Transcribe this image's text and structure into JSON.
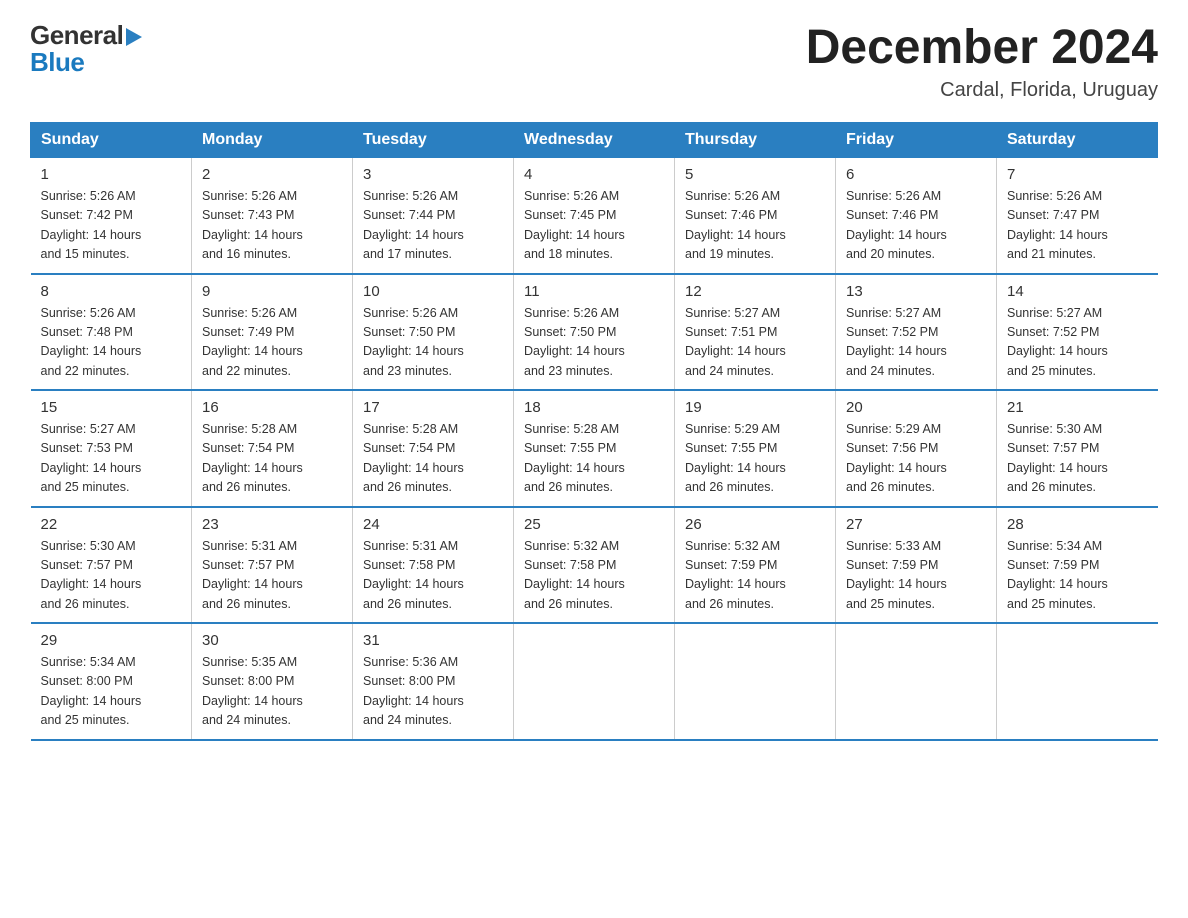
{
  "header": {
    "logo_general": "General",
    "logo_blue": "Blue",
    "month": "December 2024",
    "location": "Cardal, Florida, Uruguay"
  },
  "days_of_week": [
    "Sunday",
    "Monday",
    "Tuesday",
    "Wednesday",
    "Thursday",
    "Friday",
    "Saturday"
  ],
  "weeks": [
    [
      {
        "num": "1",
        "sunrise": "5:26 AM",
        "sunset": "7:42 PM",
        "daylight": "14 hours and 15 minutes."
      },
      {
        "num": "2",
        "sunrise": "5:26 AM",
        "sunset": "7:43 PM",
        "daylight": "14 hours and 16 minutes."
      },
      {
        "num": "3",
        "sunrise": "5:26 AM",
        "sunset": "7:44 PM",
        "daylight": "14 hours and 17 minutes."
      },
      {
        "num": "4",
        "sunrise": "5:26 AM",
        "sunset": "7:45 PM",
        "daylight": "14 hours and 18 minutes."
      },
      {
        "num": "5",
        "sunrise": "5:26 AM",
        "sunset": "7:46 PM",
        "daylight": "14 hours and 19 minutes."
      },
      {
        "num": "6",
        "sunrise": "5:26 AM",
        "sunset": "7:46 PM",
        "daylight": "14 hours and 20 minutes."
      },
      {
        "num": "7",
        "sunrise": "5:26 AM",
        "sunset": "7:47 PM",
        "daylight": "14 hours and 21 minutes."
      }
    ],
    [
      {
        "num": "8",
        "sunrise": "5:26 AM",
        "sunset": "7:48 PM",
        "daylight": "14 hours and 22 minutes."
      },
      {
        "num": "9",
        "sunrise": "5:26 AM",
        "sunset": "7:49 PM",
        "daylight": "14 hours and 22 minutes."
      },
      {
        "num": "10",
        "sunrise": "5:26 AM",
        "sunset": "7:50 PM",
        "daylight": "14 hours and 23 minutes."
      },
      {
        "num": "11",
        "sunrise": "5:26 AM",
        "sunset": "7:50 PM",
        "daylight": "14 hours and 23 minutes."
      },
      {
        "num": "12",
        "sunrise": "5:27 AM",
        "sunset": "7:51 PM",
        "daylight": "14 hours and 24 minutes."
      },
      {
        "num": "13",
        "sunrise": "5:27 AM",
        "sunset": "7:52 PM",
        "daylight": "14 hours and 24 minutes."
      },
      {
        "num": "14",
        "sunrise": "5:27 AM",
        "sunset": "7:52 PM",
        "daylight": "14 hours and 25 minutes."
      }
    ],
    [
      {
        "num": "15",
        "sunrise": "5:27 AM",
        "sunset": "7:53 PM",
        "daylight": "14 hours and 25 minutes."
      },
      {
        "num": "16",
        "sunrise": "5:28 AM",
        "sunset": "7:54 PM",
        "daylight": "14 hours and 26 minutes."
      },
      {
        "num": "17",
        "sunrise": "5:28 AM",
        "sunset": "7:54 PM",
        "daylight": "14 hours and 26 minutes."
      },
      {
        "num": "18",
        "sunrise": "5:28 AM",
        "sunset": "7:55 PM",
        "daylight": "14 hours and 26 minutes."
      },
      {
        "num": "19",
        "sunrise": "5:29 AM",
        "sunset": "7:55 PM",
        "daylight": "14 hours and 26 minutes."
      },
      {
        "num": "20",
        "sunrise": "5:29 AM",
        "sunset": "7:56 PM",
        "daylight": "14 hours and 26 minutes."
      },
      {
        "num": "21",
        "sunrise": "5:30 AM",
        "sunset": "7:57 PM",
        "daylight": "14 hours and 26 minutes."
      }
    ],
    [
      {
        "num": "22",
        "sunrise": "5:30 AM",
        "sunset": "7:57 PM",
        "daylight": "14 hours and 26 minutes."
      },
      {
        "num": "23",
        "sunrise": "5:31 AM",
        "sunset": "7:57 PM",
        "daylight": "14 hours and 26 minutes."
      },
      {
        "num": "24",
        "sunrise": "5:31 AM",
        "sunset": "7:58 PM",
        "daylight": "14 hours and 26 minutes."
      },
      {
        "num": "25",
        "sunrise": "5:32 AM",
        "sunset": "7:58 PM",
        "daylight": "14 hours and 26 minutes."
      },
      {
        "num": "26",
        "sunrise": "5:32 AM",
        "sunset": "7:59 PM",
        "daylight": "14 hours and 26 minutes."
      },
      {
        "num": "27",
        "sunrise": "5:33 AM",
        "sunset": "7:59 PM",
        "daylight": "14 hours and 25 minutes."
      },
      {
        "num": "28",
        "sunrise": "5:34 AM",
        "sunset": "7:59 PM",
        "daylight": "14 hours and 25 minutes."
      }
    ],
    [
      {
        "num": "29",
        "sunrise": "5:34 AM",
        "sunset": "8:00 PM",
        "daylight": "14 hours and 25 minutes."
      },
      {
        "num": "30",
        "sunrise": "5:35 AM",
        "sunset": "8:00 PM",
        "daylight": "14 hours and 24 minutes."
      },
      {
        "num": "31",
        "sunrise": "5:36 AM",
        "sunset": "8:00 PM",
        "daylight": "14 hours and 24 minutes."
      },
      null,
      null,
      null,
      null
    ]
  ],
  "labels": {
    "sunrise": "Sunrise:",
    "sunset": "Sunset:",
    "daylight": "Daylight:"
  },
  "colors": {
    "header_bg": "#2a7fc1",
    "border": "#2a7fc1"
  }
}
